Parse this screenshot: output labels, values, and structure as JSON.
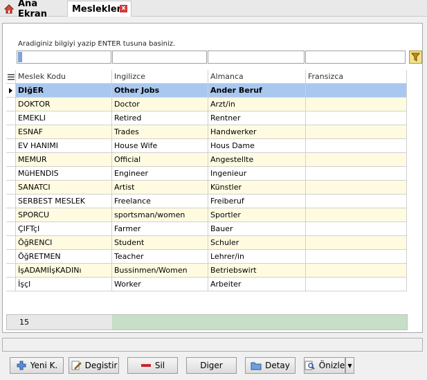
{
  "tabs": {
    "home": "Ana Ekran",
    "active": "Meslekler",
    "close": "x"
  },
  "search": {
    "hint": "Aradiginiz bilgiyi yazip ENTER tusuna basiniz."
  },
  "grid": {
    "headers": [
      "Meslek Kodu",
      "Ingilizce",
      "Almanca",
      "Fransizca"
    ],
    "rows": [
      [
        "DIğER",
        "Other Jobs",
        "Ander Beruf",
        ""
      ],
      [
        "DOKTOR",
        "Doctor",
        "Arzt/in",
        ""
      ],
      [
        "EMEKLI",
        "Retired",
        "Rentner",
        ""
      ],
      [
        "ESNAF",
        "Trades",
        "Handwerker",
        ""
      ],
      [
        "EV HANIMI",
        "House Wife",
        "Hous Dame",
        ""
      ],
      [
        "MEMUR",
        "Official",
        "Angestellte",
        ""
      ],
      [
        "MüHENDIS",
        "Engineer",
        "Ingenieur",
        ""
      ],
      [
        "SANATCI",
        "Artist",
        "Künstler",
        ""
      ],
      [
        "SERBEST MESLEK",
        "Freelance",
        "Freiberuf",
        ""
      ],
      [
        "SPORCU",
        "sportsman/women",
        "Sportler",
        ""
      ],
      [
        "ÇIFTçI",
        "Farmer",
        "Bauer",
        ""
      ],
      [
        "ÖğRENCI",
        "Student",
        "Schuler",
        ""
      ],
      [
        "ÖğRETMEN",
        "Teacher",
        "Lehrer/in",
        ""
      ],
      [
        "İşADAMIİşKADINı",
        "Bussinmen/Women",
        "Betriebswirt",
        ""
      ],
      [
        "İşçI",
        "Worker",
        "Arbeiter",
        ""
      ]
    ],
    "record_count": "15"
  },
  "buttons": {
    "new": "Yeni K.",
    "edit": "Degistir",
    "delete": "Sil",
    "other": "Diger",
    "detail": "Detay",
    "preview": "Önizle"
  },
  "colors": {
    "selected_row": "#a9c8ef",
    "alt_row": "#fffbe1",
    "footer_bar": "#c6dfc6"
  }
}
